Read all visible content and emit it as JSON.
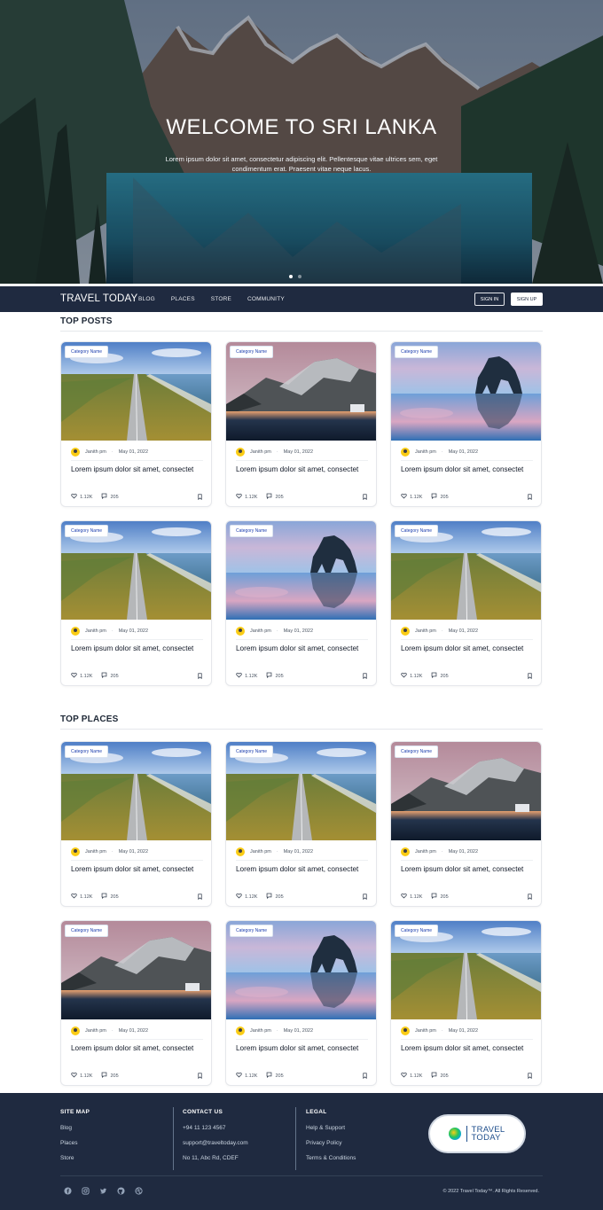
{
  "hero": {
    "title": "WELCOME TO SRI LANKA",
    "subtitle": "Lorem ipsum dolor sit amet, consectetur adipiscing elit. Pellentesque vitae ultrices sem, eget condimentum erat. Praesent vitae neque lacus."
  },
  "nav": {
    "brand": "TRAVEL TODAY",
    "links": [
      "BLOG",
      "PLACES",
      "STORE",
      "COMMUNITY"
    ],
    "signin": "SIGN IN",
    "signup": "SIGN UP"
  },
  "top_posts": {
    "title": "TOP POSTS",
    "cards": [
      {
        "category": "Category Name",
        "author": "Janith pm",
        "date": "May 01, 2022",
        "title": "Lorem ipsum dolor sit amet, consectet",
        "likes": "1.12K",
        "comments": "205",
        "image": "road"
      },
      {
        "category": "Category Name",
        "author": "Janith pm",
        "date": "May 01, 2022",
        "title": "Lorem ipsum dolor sit amet, consectet",
        "likes": "1.12K",
        "comments": "205",
        "image": "mountain"
      },
      {
        "category": "Category Name",
        "author": "Janith pm",
        "date": "May 01, 2022",
        "title": "Lorem ipsum dolor sit amet, consectet",
        "likes": "1.12K",
        "comments": "205",
        "image": "rock"
      },
      {
        "category": "Category Name",
        "author": "Janith pm",
        "date": "May 01, 2022",
        "title": "Lorem ipsum dolor sit amet, consectet",
        "likes": "1.12K",
        "comments": "205",
        "image": "road"
      },
      {
        "category": "Category Name",
        "author": "Janith pm",
        "date": "May 01, 2022",
        "title": "Lorem ipsum dolor sit amet, consectet",
        "likes": "1.12K",
        "comments": "205",
        "image": "rock"
      },
      {
        "category": "Category Name",
        "author": "Janith pm",
        "date": "May 01, 2022",
        "title": "Lorem ipsum dolor sit amet, consectet",
        "likes": "1.12K",
        "comments": "205",
        "image": "road"
      }
    ]
  },
  "top_places": {
    "title": "TOP PLACES",
    "cards": [
      {
        "category": "Category Name",
        "author": "Janith pm",
        "date": "May 01, 2022",
        "title": "Lorem ipsum dolor sit amet, consectet",
        "likes": "1.12K",
        "comments": "205",
        "image": "road"
      },
      {
        "category": "Category Name",
        "author": "Janith pm",
        "date": "May 01, 2022",
        "title": "Lorem ipsum dolor sit amet, consectet",
        "likes": "1.12K",
        "comments": "205",
        "image": "road"
      },
      {
        "category": "Category Name",
        "author": "Janith pm",
        "date": "May 01, 2022",
        "title": "Lorem ipsum dolor sit amet, consectet",
        "likes": "1.12K",
        "comments": "205",
        "image": "mountain"
      },
      {
        "category": "Category Name",
        "author": "Janith pm",
        "date": "May 01, 2022",
        "title": "Lorem ipsum dolor sit amet, consectet",
        "likes": "1.12K",
        "comments": "205",
        "image": "mountain"
      },
      {
        "category": "Category Name",
        "author": "Janith pm",
        "date": "May 01, 2022",
        "title": "Lorem ipsum dolor sit amet, consectet",
        "likes": "1.12K",
        "comments": "205",
        "image": "rock"
      },
      {
        "category": "Category Name",
        "author": "Janith pm",
        "date": "May 01, 2022",
        "title": "Lorem ipsum dolor sit amet, consectet",
        "likes": "1.12K",
        "comments": "205",
        "image": "road"
      }
    ]
  },
  "footer": {
    "sitemap": {
      "title": "SITE MAP",
      "links": [
        "Blog",
        "Places",
        "Store"
      ]
    },
    "contact": {
      "title": "CONTACT US",
      "links": [
        "+94 11 123 4567",
        "support@traveltoday.com",
        "No 11, Abc Rd, CDEF"
      ]
    },
    "legal": {
      "title": "LEGAL",
      "links": [
        "Help & Support",
        "Privacy Policy",
        "Terms & Conditions"
      ]
    },
    "logo_line1": "TRAVEL",
    "logo_line2": "TODAY",
    "socials": [
      "facebook-icon",
      "instagram-icon",
      "twitter-icon",
      "github-icon",
      "dribbble-icon"
    ],
    "copyright": "© 2022 Travel Today™. All Rights Reserved."
  },
  "colors": {
    "navy": "#1f2a40",
    "accent": "#1e40af"
  }
}
